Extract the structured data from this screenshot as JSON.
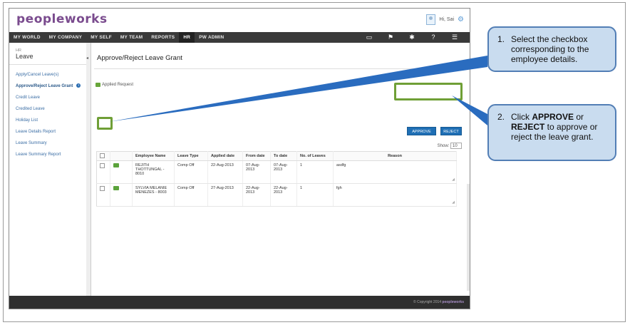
{
  "brand": {
    "logo_text": "peopleworks"
  },
  "user": {
    "greeting": "Hi, Sai"
  },
  "nav": {
    "items": [
      "MY WORLD",
      "MY COMPANY",
      "MY SELF",
      "MY TEAM",
      "REPORTS",
      "HR",
      "PW ADMIN"
    ]
  },
  "sidebar": {
    "module_small": "HR",
    "module_title": "Leave",
    "items": [
      "Apply/Cancel Leave(s)",
      "Approve/Reject Leave Grant",
      "Credit Leave",
      "Credited Leave",
      "Holiday List",
      "Leave Details Report",
      "Leave Summary",
      "Leave Summary Report"
    ]
  },
  "page": {
    "title": "Approve/Reject Leave Grant",
    "applied_label": "Applied Request"
  },
  "actions": {
    "approve": "APPROVE",
    "reject": "REJECT"
  },
  "pagination": {
    "show_label": "Show:",
    "show_value": "10"
  },
  "table": {
    "columns": [
      "",
      "",
      "Employee Name",
      "Leave Type",
      "Applied date",
      "From date",
      "To date",
      "No. of Leaves",
      "Reason"
    ],
    "rows": [
      {
        "employee": "REJITH THOTTUNGAL - 8010",
        "type": "Comp Off",
        "applied": "22-Aug-2013",
        "from": "07-Aug-2013",
        "to": "07-Aug-2013",
        "count": "1",
        "reason": "asdfg"
      },
      {
        "employee": "SYLVIA MELANIE MENEZES - 8003",
        "type": "Comp Off",
        "applied": "27-Aug-2013",
        "from": "22-Aug-2013",
        "to": "22-Aug-2013",
        "count": "1",
        "reason": "fgh"
      }
    ]
  },
  "footer": {
    "copyright": "© Copyright 2014",
    "brand": "peopleworks"
  },
  "callouts": [
    {
      "num": "1.",
      "text": "Select the checkbox corresponding to the employee details."
    },
    {
      "num": "2.",
      "pre": "Click ",
      "b1": "APPROVE",
      "mid": " or ",
      "b2": "REJECT",
      "post": " to approve or reject the leave grant."
    }
  ],
  "colors": {
    "nav_bg": "#3a3a3a",
    "button_blue": "#1f6fb5",
    "highlight_green": "#6f9f36",
    "callout_fill": "#c9dcef",
    "callout_border": "#527eb5"
  }
}
